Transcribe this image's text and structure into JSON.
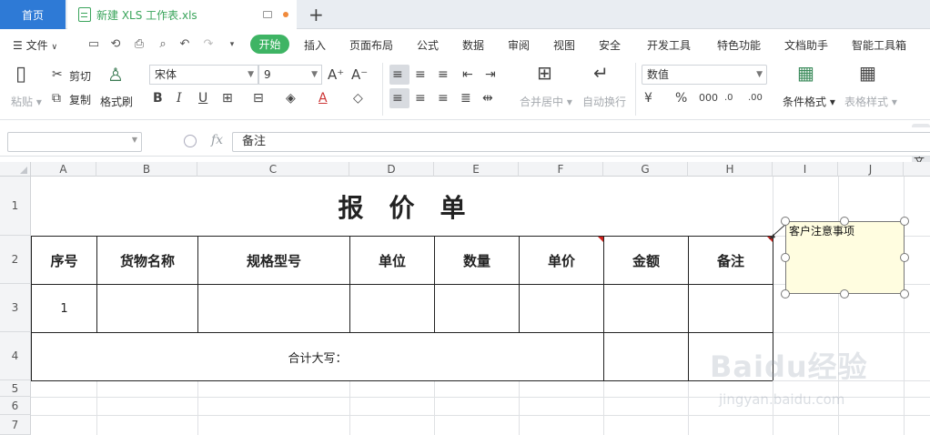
{
  "tabs": {
    "home": "首页",
    "file": "新建 XLS 工作表.xls",
    "add": "+"
  },
  "menu": {
    "file": "文件",
    "items": [
      "开始",
      "插入",
      "页面布局",
      "公式",
      "数据",
      "审阅",
      "视图",
      "安全",
      "开发工具",
      "特色功能",
      "文档助手",
      "智能工具箱"
    ]
  },
  "ribbon": {
    "paste": "粘贴",
    "cut": "剪切",
    "copy": "复制",
    "format_painter": "格式刷",
    "font_name": "宋体",
    "font_size": "9",
    "merge": "合并居中",
    "wrap": "自动换行",
    "number_format": "数值",
    "cond_format": "条件格式",
    "table_style": "表格样式",
    "doc": "文"
  },
  "formula_bar": {
    "fx": "fx",
    "value": "备注"
  },
  "columns": [
    "A",
    "B",
    "C",
    "D",
    "E",
    "F",
    "G",
    "H",
    "I",
    "J"
  ],
  "rows": [
    "1",
    "2",
    "3",
    "4",
    "5",
    "6",
    "7"
  ],
  "sheet": {
    "title": "报　价　单",
    "headers": [
      "序号",
      "货物名称",
      "规格型号",
      "单位",
      "数量",
      "单价",
      "金额",
      "备注"
    ],
    "row3_a": "1",
    "total_label": "合计大写：",
    "comment": "客户注意事项"
  },
  "watermark": {
    "brand": "Baidu经验",
    "url": "jingyan.baidu.com"
  },
  "colors": {
    "accent": "#2e7ad6",
    "start_tab": "#3eb464",
    "comment_fill": "#fffde0"
  }
}
